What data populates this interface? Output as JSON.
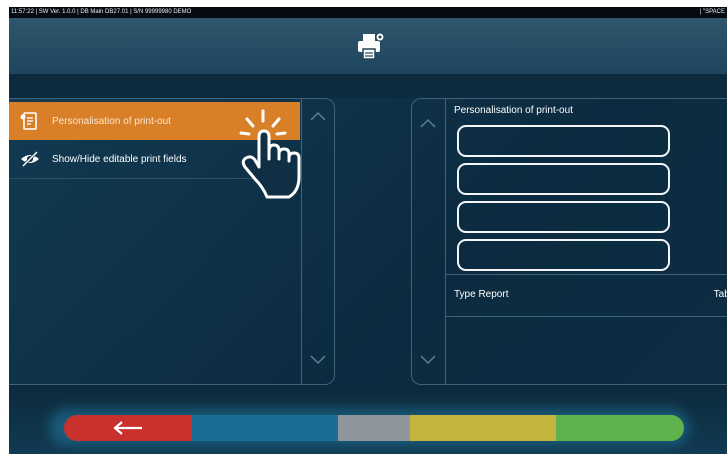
{
  "status_bar": {
    "left_text": "11:57:22  |  SW Ver. 1.0.0  |  DB Main DB27.01  |  S/N 99999980 DEMO",
    "right_text": "|  \"SPACE"
  },
  "header": {
    "icon": "printer-settings-icon"
  },
  "menu": {
    "items": [
      {
        "label": "Personalisation of print-out",
        "icon": "document-settings-icon",
        "active": true
      },
      {
        "label": "Show/Hide editable print fields",
        "icon": "eye-slash-icon",
        "active": false
      }
    ]
  },
  "right_panel": {
    "title": "Personalisation of print-out",
    "fields": [
      "",
      "",
      "",
      ""
    ],
    "type_report_label": "Type Report",
    "type_report_value": "Tabl"
  },
  "bottom_bar": {
    "buttons": [
      {
        "name": "back",
        "color": "#c8312d"
      },
      {
        "name": "blue",
        "color": "#1a6c96"
      },
      {
        "name": "grey",
        "color": "#8e969c"
      },
      {
        "name": "yellow",
        "color": "#c4b43d"
      },
      {
        "name": "green",
        "color": "#5fb24c"
      }
    ]
  },
  "colors": {
    "accent_orange": "#d97f28",
    "background": "#0d2f46"
  }
}
